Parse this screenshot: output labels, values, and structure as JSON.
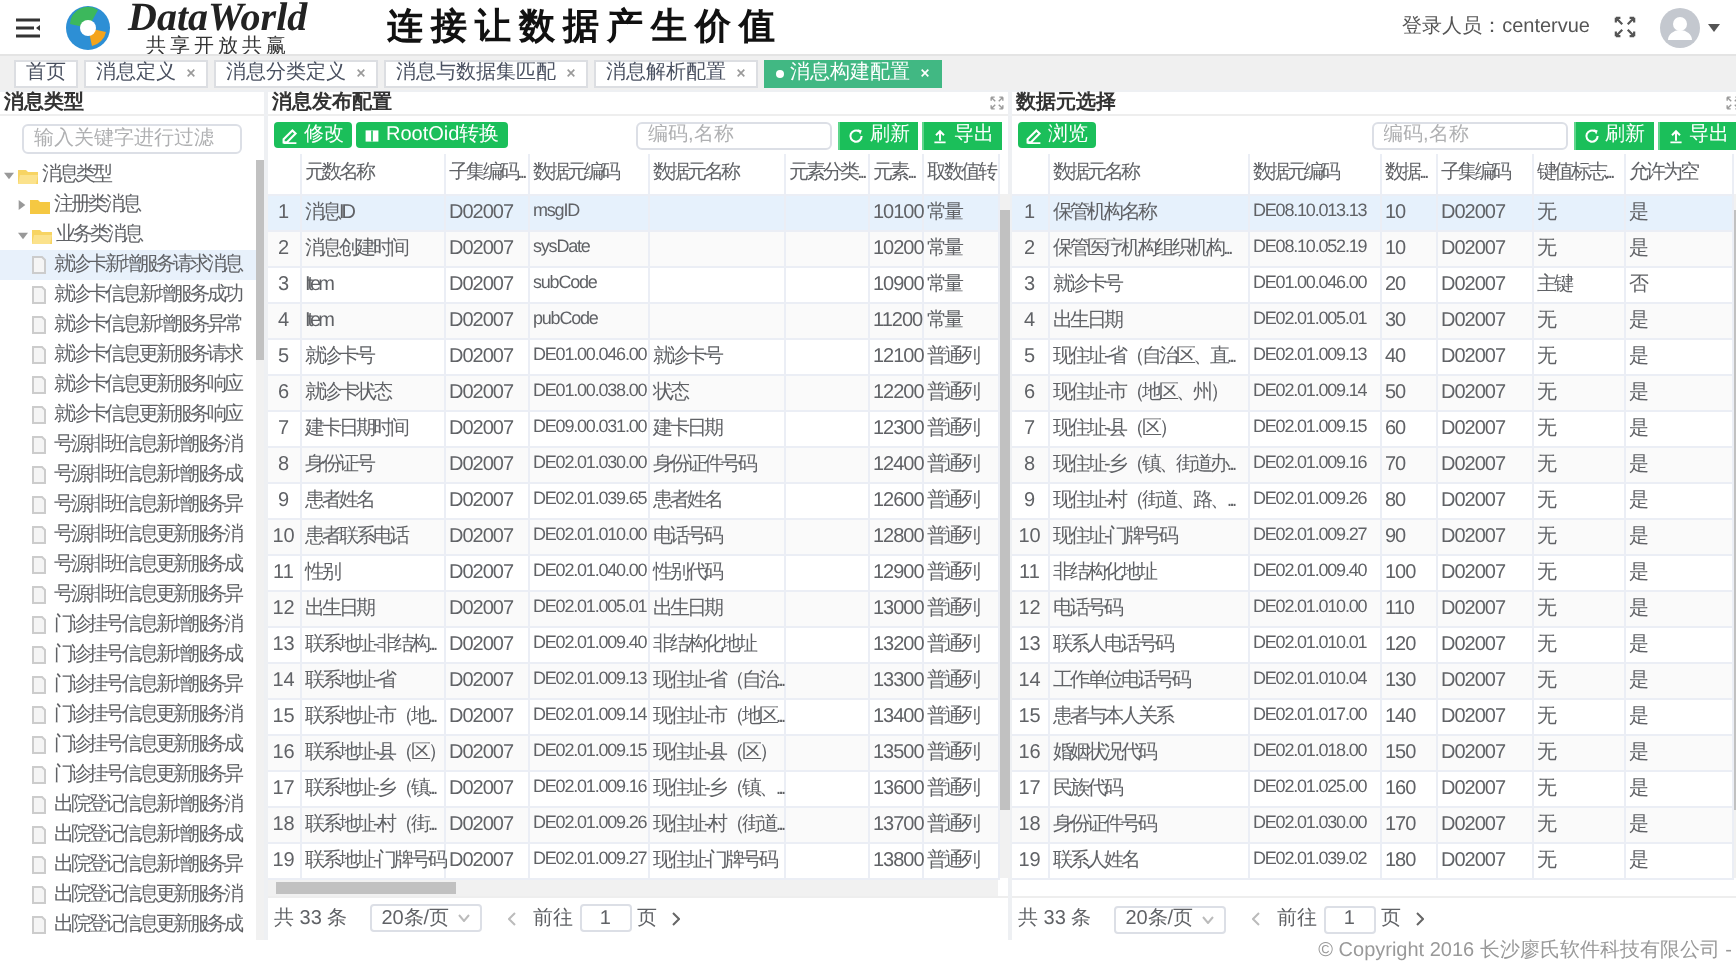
{
  "header": {
    "brand": "DataWorld",
    "tagline": "共享开放共赢",
    "slogan": "连接让数据产生价值",
    "login": "登录人员：centervue"
  },
  "tabs": [
    {
      "label": "首页",
      "selected": false,
      "closable": false
    },
    {
      "label": "消息定义",
      "selected": false,
      "closable": true
    },
    {
      "label": "消息分类定义",
      "selected": false,
      "closable": true
    },
    {
      "label": "消息与数据集匹配",
      "selected": false,
      "closable": true
    },
    {
      "label": "消息解析配置",
      "selected": false,
      "closable": true
    },
    {
      "label": "消息构建配置",
      "selected": true,
      "closable": true
    }
  ],
  "type_panel": {
    "title": "消息类型",
    "filter_placeholder": "输入关键字进行过滤",
    "tree": [
      {
        "label": "消息类型",
        "kind": "folder",
        "expanded": true,
        "selected": false,
        "children": [
          {
            "label": "注册类消息",
            "kind": "folder",
            "expanded": false,
            "selected": false
          },
          {
            "label": "业务类消息",
            "kind": "folder",
            "expanded": true,
            "selected": false,
            "children": [
              {
                "label": "就诊卡新增服务请求消息",
                "kind": "leaf",
                "selected": true
              },
              {
                "label": "就诊卡信息新增服务成功",
                "kind": "leaf",
                "selected": false
              },
              {
                "label": "就诊卡信息新增服务异常",
                "kind": "leaf",
                "selected": false
              },
              {
                "label": "就诊卡信息更新服务请求",
                "kind": "leaf",
                "selected": false
              },
              {
                "label": "就诊卡信息更新服务响应",
                "kind": "leaf",
                "selected": false
              },
              {
                "label": "就诊卡信息更新服务响应",
                "kind": "leaf",
                "selected": false
              },
              {
                "label": "号源排班信息新增服务消",
                "kind": "leaf",
                "selected": false
              },
              {
                "label": "号源排班信息新增服务成",
                "kind": "leaf",
                "selected": false
              },
              {
                "label": "号源排班信息新增服务异",
                "kind": "leaf",
                "selected": false
              },
              {
                "label": "号源排班信息更新服务消",
                "kind": "leaf",
                "selected": false
              },
              {
                "label": "号源排班信息更新服务成",
                "kind": "leaf",
                "selected": false
              },
              {
                "label": "号源排班信息更新服务异",
                "kind": "leaf",
                "selected": false
              },
              {
                "label": "门诊挂号信息新增服务消",
                "kind": "leaf",
                "selected": false
              },
              {
                "label": "门诊挂号信息新增服务成",
                "kind": "leaf",
                "selected": false
              },
              {
                "label": "门诊挂号信息新增服务异",
                "kind": "leaf",
                "selected": false
              },
              {
                "label": "门诊挂号信息更新服务消",
                "kind": "leaf",
                "selected": false
              },
              {
                "label": "门诊挂号信息更新服务成",
                "kind": "leaf",
                "selected": false
              },
              {
                "label": "门诊挂号信息更新服务异",
                "kind": "leaf",
                "selected": false
              },
              {
                "label": "出院登记信息新增服务消",
                "kind": "leaf",
                "selected": false
              },
              {
                "label": "出院登记信息新增服务成",
                "kind": "leaf",
                "selected": false
              },
              {
                "label": "出院登记信息新增服务异",
                "kind": "leaf",
                "selected": false
              },
              {
                "label": "出院登记信息更新服务消",
                "kind": "leaf",
                "selected": false
              },
              {
                "label": "出院登记信息更新服务成",
                "kind": "leaf",
                "selected": false
              }
            ]
          }
        ]
      }
    ]
  },
  "publish_panel": {
    "title": "消息发布配置",
    "tools": [
      {
        "label": "修改",
        "kind": "edit"
      },
      {
        "label": "RootOid转换",
        "kind": "book"
      }
    ],
    "search_placeholder": "编码,名称",
    "actions": [
      {
        "label": "刷新",
        "kind": "refresh"
      },
      {
        "label": "导出",
        "kind": "export"
      }
    ],
    "table": {
      "columns": [
        "元数名称",
        "子集编码...",
        "数据元编码",
        "数据元名称",
        "元素分类...",
        "元素...",
        "取数值转"
      ],
      "rows": [
        {
          "index": "1",
          "selected": true,
          "cells": [
            "消息ID",
            "D02007",
            "msgID",
            null,
            null,
            "10100",
            "常量"
          ]
        },
        {
          "index": "2",
          "selected": false,
          "cells": [
            "消息创建时间",
            "D02007",
            "sysDate",
            null,
            null,
            "10200",
            "常量"
          ]
        },
        {
          "index": "3",
          "selected": false,
          "cells": [
            "Item",
            "D02007",
            "subCode",
            null,
            null,
            "10900",
            "常量"
          ]
        },
        {
          "index": "4",
          "selected": false,
          "cells": [
            "Item",
            "D02007",
            "pubCode",
            null,
            null,
            "11200",
            "常量"
          ]
        },
        {
          "index": "5",
          "selected": false,
          "cells": [
            "就诊卡号",
            "D02007",
            "DE01.00.046.00",
            "就诊卡号",
            null,
            "12100",
            "普通列"
          ]
        },
        {
          "index": "6",
          "selected": false,
          "cells": [
            "就诊卡状态",
            "D02007",
            "DE01.00.038.00",
            "状态",
            null,
            "12200",
            "普通列"
          ]
        },
        {
          "index": "7",
          "selected": false,
          "cells": [
            "建卡日期时间",
            "D02007",
            "DE09.00.031.00",
            "建卡日期",
            null,
            "12300",
            "普通列"
          ]
        },
        {
          "index": "8",
          "selected": false,
          "cells": [
            "身份证号",
            "D02007",
            "DE02.01.030.00",
            "身份证件号码",
            null,
            "12400",
            "普通列"
          ]
        },
        {
          "index": "9",
          "selected": false,
          "cells": [
            "患者姓名",
            "D02007",
            "DE02.01.039.65",
            "患者姓名",
            null,
            "12600",
            "普通列"
          ]
        },
        {
          "index": "10",
          "selected": false,
          "cells": [
            "患者联系电话",
            "D02007",
            "DE02.01.010.00",
            "电话号码",
            null,
            "12800",
            "普通列"
          ]
        },
        {
          "index": "11",
          "selected": false,
          "cells": [
            "性别",
            "D02007",
            "DE02.01.040.00",
            "性别代码",
            null,
            "12900",
            "普通列"
          ]
        },
        {
          "index": "12",
          "selected": false,
          "cells": [
            "出生日期",
            "D02007",
            "DE02.01.005.01",
            "出生日期",
            null,
            "13000",
            "普通列"
          ]
        },
        {
          "index": "13",
          "selected": false,
          "cells": [
            "联系地址-非结构...",
            "D02007",
            "DE02.01.009.40",
            "非结构化地址",
            null,
            "13200",
            "普通列"
          ]
        },
        {
          "index": "14",
          "selected": false,
          "cells": [
            "联系地址-省",
            "D02007",
            "DE02.01.009.13",
            "现住址-省（自治...",
            null,
            "13300",
            "普通列"
          ]
        },
        {
          "index": "15",
          "selected": false,
          "cells": [
            "联系地址-市（地...",
            "D02007",
            "DE02.01.009.14",
            "现住址-市（地区...",
            null,
            "13400",
            "普通列"
          ]
        },
        {
          "index": "16",
          "selected": false,
          "cells": [
            "联系地址-县（区）",
            "D02007",
            "DE02.01.009.15",
            "现住址-县（区）",
            null,
            "13500",
            "普通列"
          ]
        },
        {
          "index": "17",
          "selected": false,
          "cells": [
            "联系地址-乡（镇...",
            "D02007",
            "DE02.01.009.16",
            "现住址-乡（镇、...",
            null,
            "13600",
            "普通列"
          ]
        },
        {
          "index": "18",
          "selected": false,
          "cells": [
            "联系地址-村（街...",
            "D02007",
            "DE02.01.009.26",
            "现住址-村（街道...",
            null,
            "13700",
            "普通列"
          ]
        },
        {
          "index": "19",
          "selected": false,
          "cells": [
            "联系地址-门牌号码",
            "D02007",
            "DE02.01.009.27",
            "现住址-门牌号码",
            null,
            "13800",
            "普通列"
          ]
        }
      ]
    },
    "pagination": {
      "total": "共 33 条",
      "page_size": "20条/页",
      "goto": "前往",
      "page": "1",
      "unit": "页"
    }
  },
  "element_panel": {
    "title": "数据元选择",
    "tools": [
      {
        "label": "浏览",
        "kind": "edit"
      }
    ],
    "search_placeholder": "编码,名称",
    "actions": [
      {
        "label": "刷新",
        "kind": "refresh"
      },
      {
        "label": "导出",
        "kind": "export"
      }
    ],
    "table": {
      "columns": [
        "数据元名称",
        "数据元编码",
        "数据...",
        "子集编码",
        "键值标志...",
        "允许为空"
      ],
      "rows": [
        {
          "index": "1",
          "selected": true,
          "cells": [
            "保管机构名称",
            "DE08.10.013.13",
            "10",
            "D02007",
            "无",
            "是"
          ]
        },
        {
          "index": "2",
          "selected": false,
          "cells": [
            "保管医疗机构组织机构...",
            "DE08.10.052.19",
            "10",
            "D02007",
            "无",
            "是"
          ]
        },
        {
          "index": "3",
          "selected": false,
          "cells": [
            "就诊卡号",
            "DE01.00.046.00",
            "20",
            "D02007",
            "主键",
            "否"
          ]
        },
        {
          "index": "4",
          "selected": false,
          "cells": [
            "出生日期",
            "DE02.01.005.01",
            "30",
            "D02007",
            "无",
            "是"
          ]
        },
        {
          "index": "5",
          "selected": false,
          "cells": [
            "现住址-省（自治区、直...",
            "DE02.01.009.13",
            "40",
            "D02007",
            "无",
            "是"
          ]
        },
        {
          "index": "6",
          "selected": false,
          "cells": [
            "现住址-市（地区、州）",
            "DE02.01.009.14",
            "50",
            "D02007",
            "无",
            "是"
          ]
        },
        {
          "index": "7",
          "selected": false,
          "cells": [
            "现住址-县（区）",
            "DE02.01.009.15",
            "60",
            "D02007",
            "无",
            "是"
          ]
        },
        {
          "index": "8",
          "selected": false,
          "cells": [
            "现住址-乡（镇、街道办...",
            "DE02.01.009.16",
            "70",
            "D02007",
            "无",
            "是"
          ]
        },
        {
          "index": "9",
          "selected": false,
          "cells": [
            "现住址-村（街道、路、...",
            "DE02.01.009.26",
            "80",
            "D02007",
            "无",
            "是"
          ]
        },
        {
          "index": "10",
          "selected": false,
          "cells": [
            "现住址-门牌号码",
            "DE02.01.009.27",
            "90",
            "D02007",
            "无",
            "是"
          ]
        },
        {
          "index": "11",
          "selected": false,
          "cells": [
            "非结构化地址",
            "DE02.01.009.40",
            "100",
            "D02007",
            "无",
            "是"
          ]
        },
        {
          "index": "12",
          "selected": false,
          "cells": [
            "电话号码",
            "DE02.01.010.00",
            "110",
            "D02007",
            "无",
            "是"
          ]
        },
        {
          "index": "13",
          "selected": false,
          "cells": [
            "联系人电话号码",
            "DE02.01.010.01",
            "120",
            "D02007",
            "无",
            "是"
          ]
        },
        {
          "index": "14",
          "selected": false,
          "cells": [
            "工作单位电话号码",
            "DE02.01.010.04",
            "130",
            "D02007",
            "无",
            "是"
          ]
        },
        {
          "index": "15",
          "selected": false,
          "cells": [
            "患者与本人关系",
            "DE02.01.017.00",
            "140",
            "D02007",
            "无",
            "是"
          ]
        },
        {
          "index": "16",
          "selected": false,
          "cells": [
            "婚姻状况代码",
            "DE02.01.018.00",
            "150",
            "D02007",
            "无",
            "是"
          ]
        },
        {
          "index": "17",
          "selected": false,
          "cells": [
            "民族代码",
            "DE02.01.025.00",
            "160",
            "D02007",
            "无",
            "是"
          ]
        },
        {
          "index": "18",
          "selected": false,
          "cells": [
            "身份证件号码",
            "DE02.01.030.00",
            "170",
            "D02007",
            "无",
            "是"
          ]
        },
        {
          "index": "19",
          "selected": false,
          "cells": [
            "联系人姓名",
            "DE02.01.039.02",
            "180",
            "D02007",
            "无",
            "是"
          ]
        }
      ]
    },
    "pagination": {
      "total": "共 33 条",
      "page_size": "20条/页",
      "goto": "前往",
      "page": "1",
      "unit": "页"
    }
  },
  "footer": "© Copyright 2016 长沙廖氏软件科技有限公司 -"
}
